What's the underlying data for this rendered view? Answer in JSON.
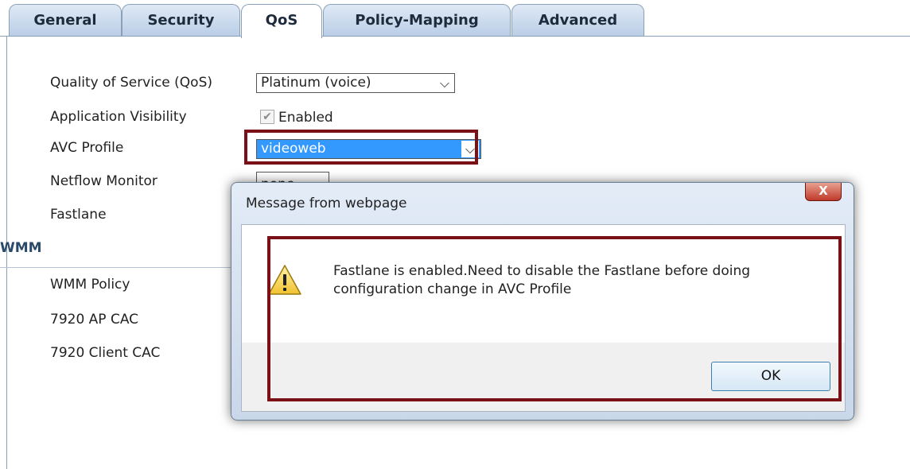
{
  "tabs": [
    {
      "label": "General",
      "active": false
    },
    {
      "label": "Security",
      "active": false
    },
    {
      "label": "QoS",
      "active": true
    },
    {
      "label": "Policy-Mapping",
      "active": false
    },
    {
      "label": "Advanced",
      "active": false
    }
  ],
  "form": {
    "qos_label": "Quality of Service (QoS)",
    "qos_value": "Platinum (voice)",
    "app_vis_label": "Application Visibility",
    "app_vis_checkbox_label": "Enabled",
    "app_vis_checked": true,
    "avc_label": "AVC Profile",
    "avc_value": "videoweb",
    "netflow_label": "Netflow Monitor",
    "netflow_value": "none",
    "fastlane_label": "Fastlane"
  },
  "wmm": {
    "title": "WMM",
    "policy_label": "WMM Policy",
    "ap_cac_label": "7920 AP CAC",
    "client_cac_label": "7920 Client CAC"
  },
  "dialog": {
    "title": "Message from webpage",
    "close_label": "X",
    "message_line1": "Fastlane is enabled.Need to disable the Fastlane before doing",
    "message_line2": "configuration change in AVC Profile",
    "ok_label": "OK",
    "icon": "warning-icon"
  },
  "colors": {
    "highlight": "#7b1016",
    "selection": "#3399ff",
    "section_title": "#2b4a6b"
  }
}
